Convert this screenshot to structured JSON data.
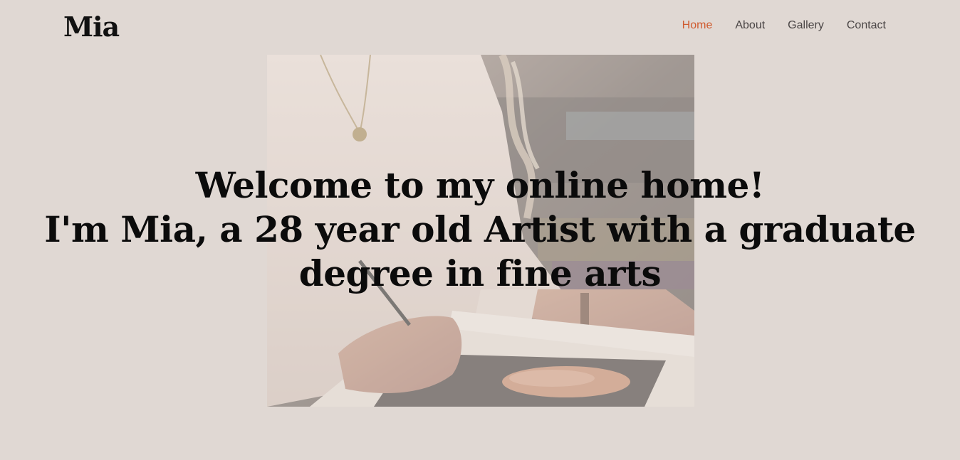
{
  "site": {
    "logo": "Mia"
  },
  "nav": {
    "items": [
      {
        "label": "Home",
        "active": true
      },
      {
        "label": "About",
        "active": false
      },
      {
        "label": "Gallery",
        "active": false
      },
      {
        "label": "Contact",
        "active": false
      }
    ],
    "active_color": "#cf5a2e",
    "text_color": "#4a4545"
  },
  "hero": {
    "image_icon": "artist-drawing-photo",
    "headline_lines": [
      "Welcome to my online home!",
      "I'm Mia, a 28 year old Artist with a graduate",
      "degree in fine arts"
    ]
  },
  "colors": {
    "background": "#e0d8d3",
    "headline": "#0b0b0b"
  }
}
